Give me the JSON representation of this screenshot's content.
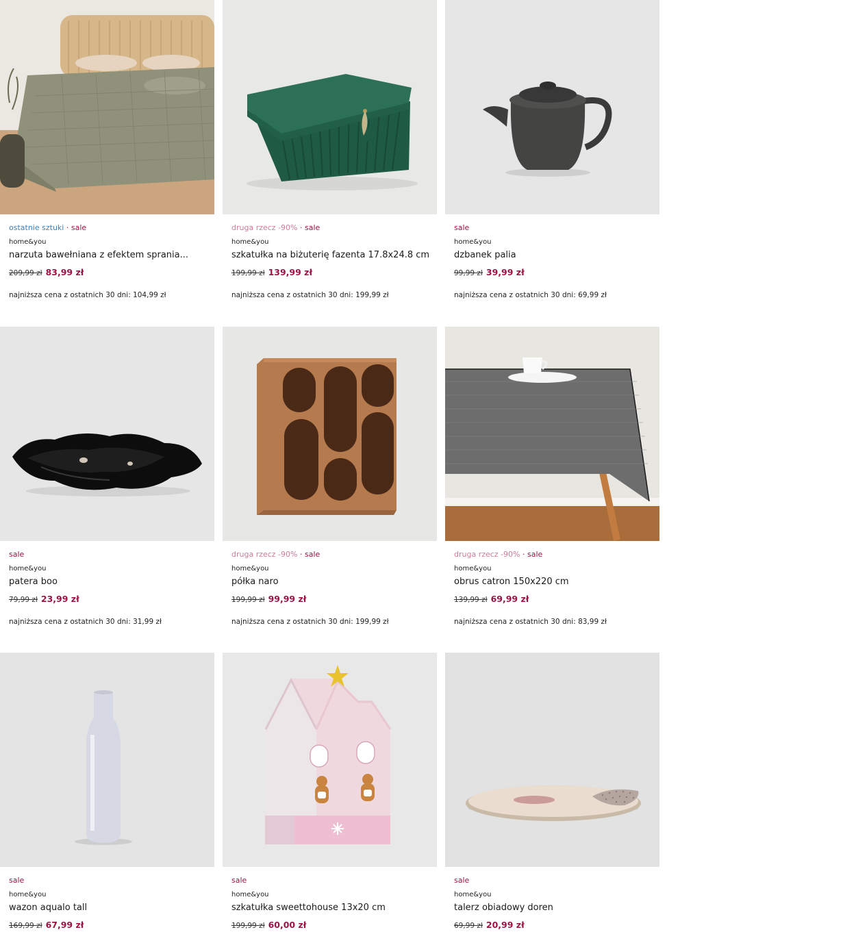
{
  "products": [
    {
      "tags": [
        "ostatnie sztuki",
        "sale"
      ],
      "brand": "home&you",
      "name": "narzuta bawełniana z efektem sprania...",
      "old_price": "209,99 zł",
      "new_price": "83,99 zł",
      "lowest": "najniższa cena z ostatnich 30 dni: 104,99 zł"
    },
    {
      "tags": [
        "druga rzecz -90%",
        "sale"
      ],
      "brand": "home&you",
      "name": "szkatułka na biżuterię fazenta 17.8x24.8 cm",
      "old_price": "199,99 zł",
      "new_price": "139,99 zł",
      "lowest": "najniższa cena z ostatnich 30 dni: 199,99 zł"
    },
    {
      "tags": [
        "sale"
      ],
      "brand": "home&you",
      "name": "dzbanek palia",
      "old_price": "99,99 zł",
      "new_price": "39,99 zł",
      "lowest": "najniższa cena z ostatnich 30 dni: 69,99 zł"
    },
    {
      "tags": [
        "sale"
      ],
      "brand": "home&you",
      "name": "patera boo",
      "old_price": "79,99 zł",
      "new_price": "23,99 zł",
      "lowest": "najniższa cena z ostatnich 30 dni: 31,99 zł"
    },
    {
      "tags": [
        "druga rzecz -90%",
        "sale"
      ],
      "brand": "home&you",
      "name": "półka naro",
      "old_price": "199,99 zł",
      "new_price": "99,99 zł",
      "lowest": "najniższa cena z ostatnich 30 dni: 199,99 zł"
    },
    {
      "tags": [
        "druga rzecz -90%",
        "sale"
      ],
      "brand": "home&you",
      "name": "obrus catron 150x220 cm",
      "old_price": "139,99 zł",
      "new_price": "69,99 zł",
      "lowest": "najniższa cena z ostatnich 30 dni: 83,99 zł"
    },
    {
      "tags": [
        "sale"
      ],
      "brand": "home&you",
      "name": "wazon aqualo tall",
      "old_price": "169,99 zł",
      "new_price": "67,99 zł",
      "lowest": ""
    },
    {
      "tags": [
        "sale"
      ],
      "brand": "home&you",
      "name": "szkatułka sweettohouse 13x20 cm",
      "old_price": "199,99 zł",
      "new_price": "60,00 zł",
      "lowest": ""
    },
    {
      "tags": [
        "sale"
      ],
      "brand": "home&you",
      "name": "talerz obiadowy doren",
      "old_price": "69,99 zł",
      "new_price": "20,99 zł",
      "lowest": ""
    }
  ],
  "product_images": [
    "bedspread-image",
    "jewelry-box-image",
    "teapot-image",
    "platter-image",
    "shelf-image",
    "tablecloth-image",
    "vase-image",
    "gingerbread-house-box-image",
    "dinner-plate-image"
  ],
  "colors": {
    "sale": "#9c1446",
    "last_items": "#3d7fb5",
    "second_item": "#d17a98",
    "image_bg": "#e9e9e9"
  }
}
